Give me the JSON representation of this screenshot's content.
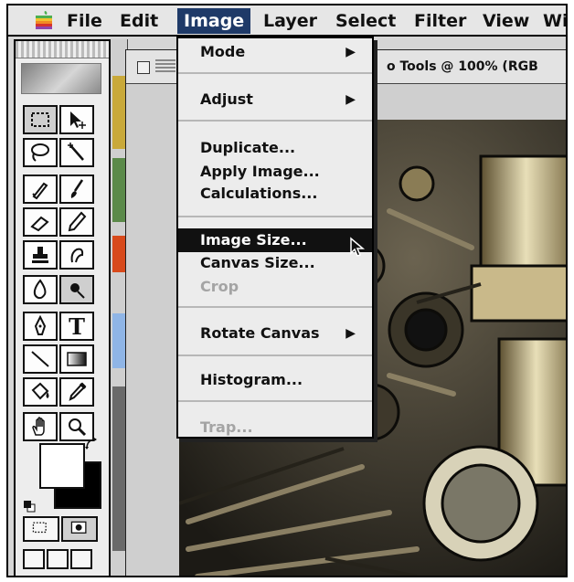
{
  "menubar": {
    "apple_icon": "apple-icon",
    "items": [
      "File",
      "Edit",
      "Image",
      "Layer",
      "Select",
      "Filter",
      "View",
      "Wi"
    ],
    "active": "Image"
  },
  "document": {
    "title": "o Tools @ 100% (RGB"
  },
  "image_menu": {
    "items": [
      {
        "label": "Mode",
        "submenu": true,
        "enabled": true
      },
      {
        "label": "Adjust",
        "submenu": true,
        "enabled": true
      },
      {
        "label": "Duplicate...",
        "submenu": false,
        "enabled": true
      },
      {
        "label": "Apply Image...",
        "submenu": false,
        "enabled": true
      },
      {
        "label": "Calculations...",
        "submenu": false,
        "enabled": true
      },
      {
        "label": "Image Size...",
        "submenu": false,
        "enabled": true,
        "highlighted": true
      },
      {
        "label": "Canvas Size...",
        "submenu": false,
        "enabled": true
      },
      {
        "label": "Crop",
        "submenu": false,
        "enabled": false
      },
      {
        "label": "Rotate Canvas",
        "submenu": true,
        "enabled": true
      },
      {
        "label": "Histogram...",
        "submenu": false,
        "enabled": true
      },
      {
        "label": "Trap...",
        "submenu": false,
        "enabled": false
      }
    ],
    "arrow_glyph": "▶"
  },
  "toolbox": {
    "tools": [
      "marquee-tool",
      "move-tool",
      "lasso-tool",
      "magic-wand-tool",
      "airbrush-tool",
      "paintbrush-tool",
      "eraser-tool",
      "pencil-tool",
      "rubber-stamp-tool",
      "smudge-tool",
      "dodge-tool",
      "sharpen-tool",
      "pen-tool",
      "type-tool",
      "line-tool",
      "gradient-tool",
      "paint-bucket-tool",
      "eyedropper-tool",
      "hand-tool",
      "zoom-tool"
    ],
    "type_glyph": "T",
    "colors": {
      "foreground": "#ffffff",
      "background": "#000000"
    }
  },
  "colors": {
    "menu_highlight": "#1f3a68",
    "item_highlight": "#111111",
    "disabled_text": "#a4a4a4"
  }
}
